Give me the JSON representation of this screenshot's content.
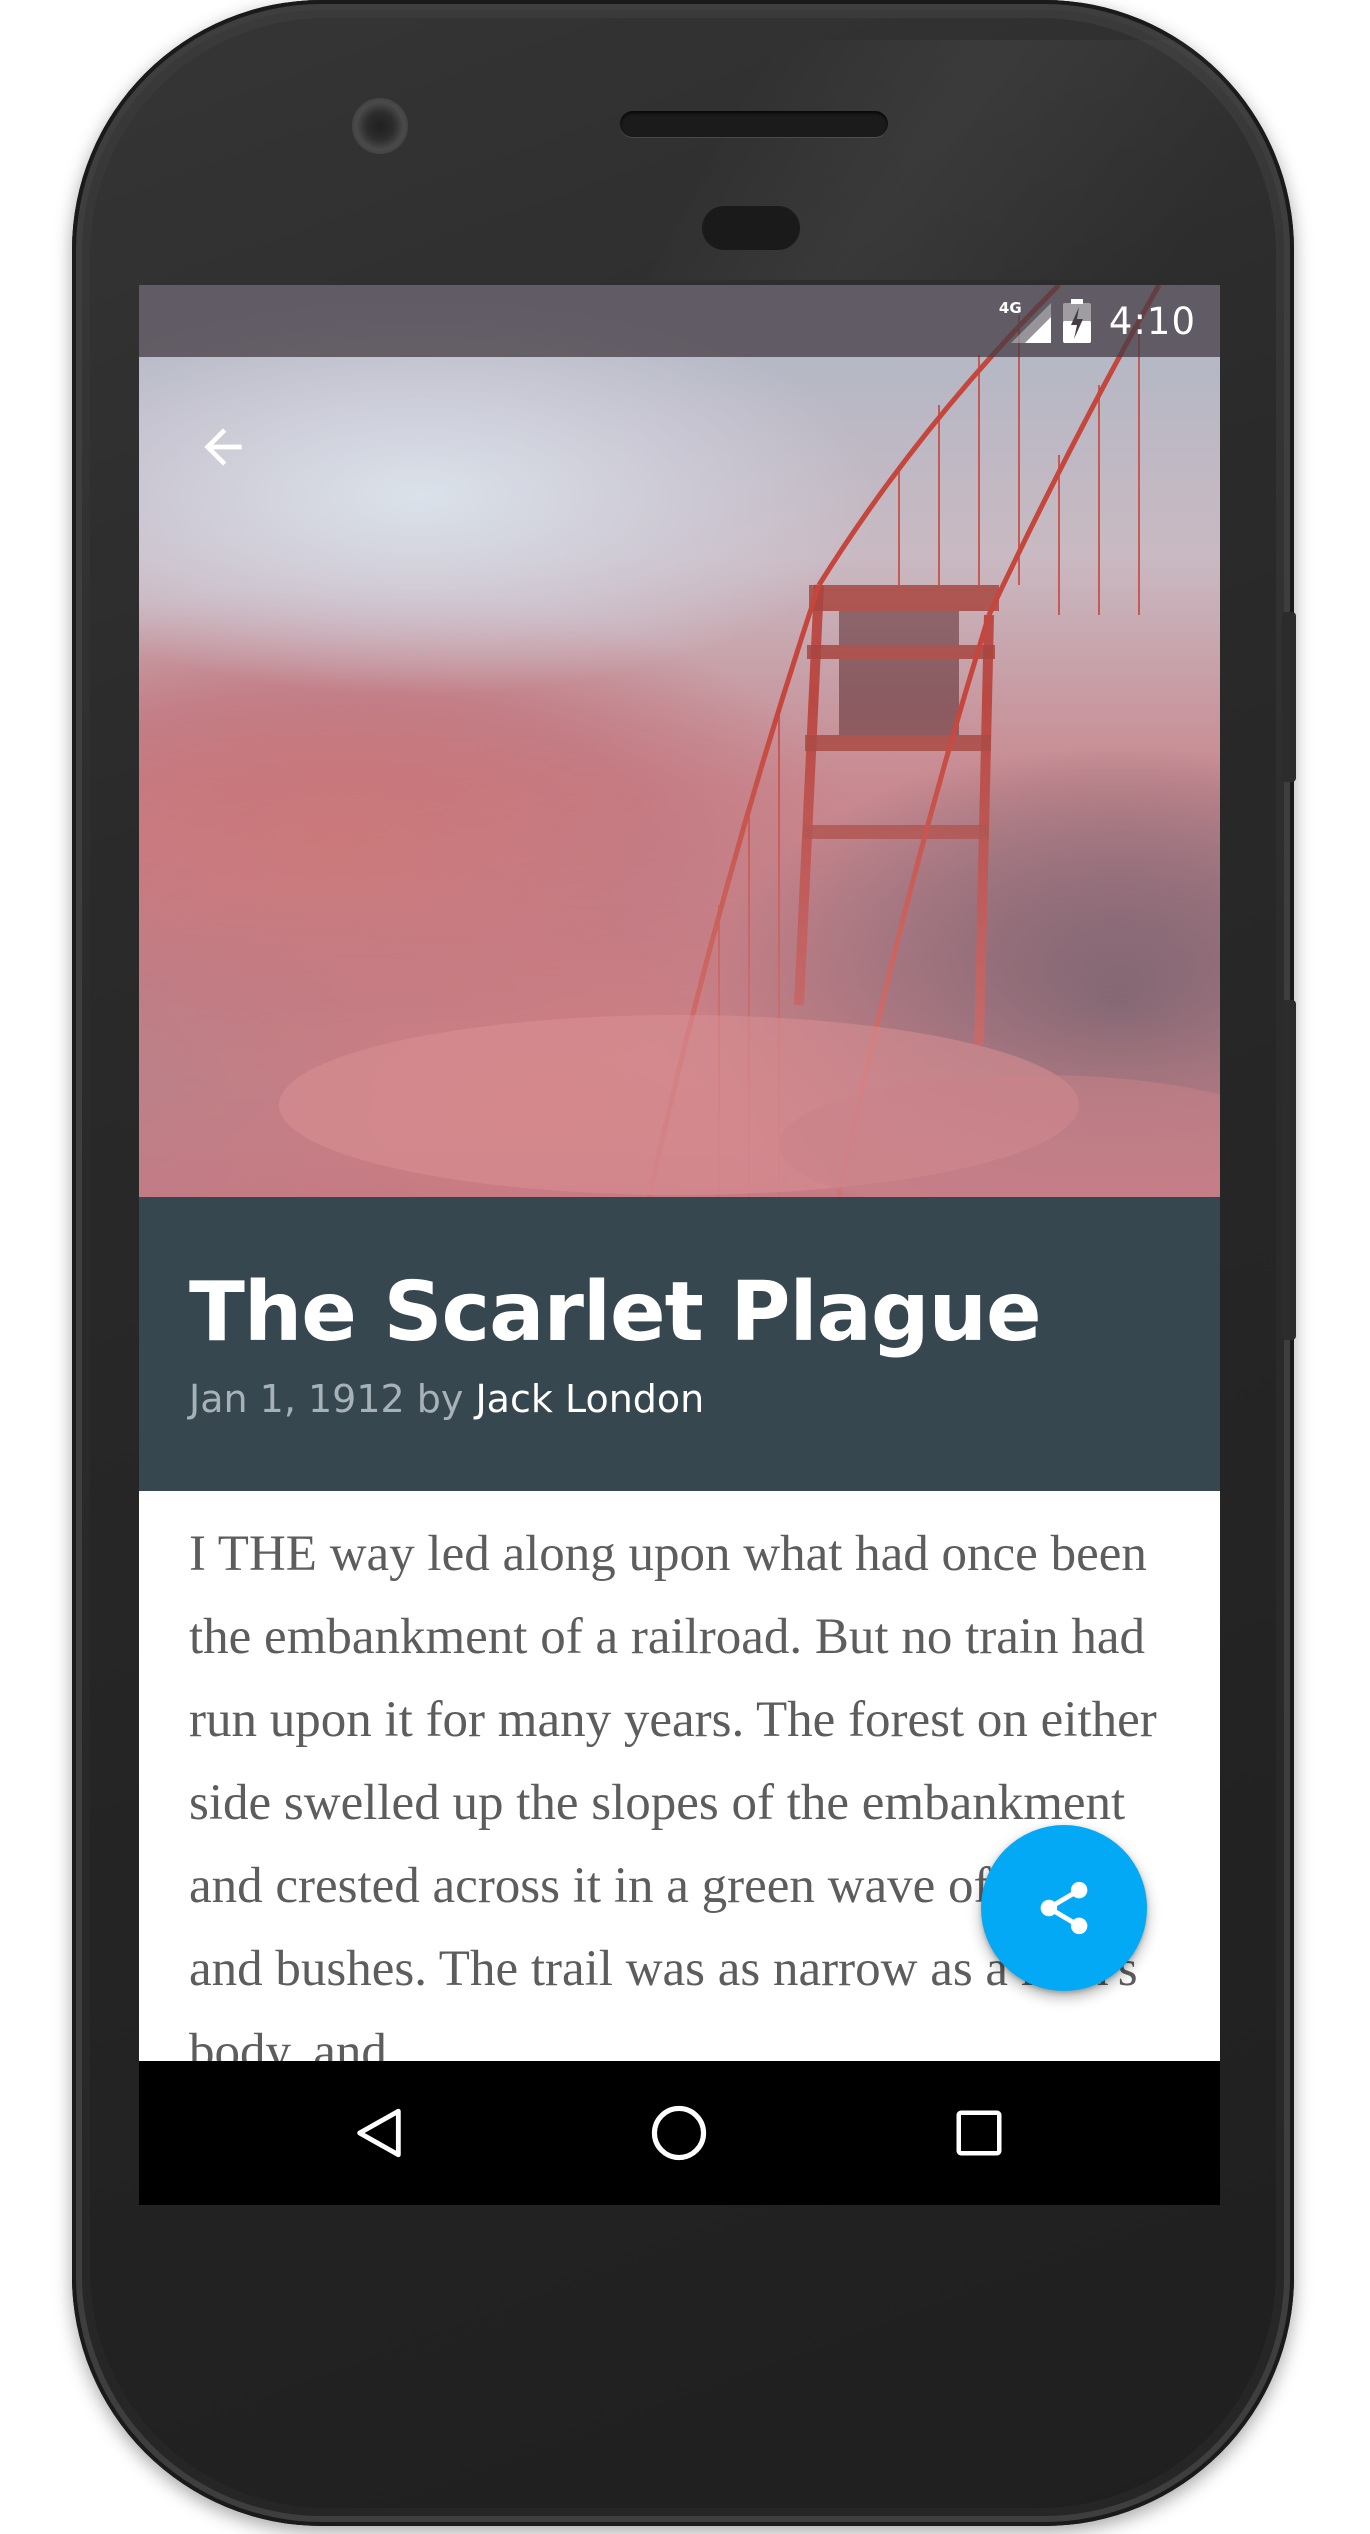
{
  "status_bar": {
    "network_label": "4G",
    "time": "4:10"
  },
  "hero": {
    "image_label": "fog-bridge-photo"
  },
  "article": {
    "title": "The Scarlet Plague",
    "date_prefix": "Jan 1, 1912 by ",
    "author": "Jack London",
    "body": "I THE way led along upon what had once been the embankment of a railroad. But no train had run upon it for many years. The forest on either side swelled up the slopes of the embankment and crested across it in a green wave of trees and bushes. The trail was as narrow as a man's body, and"
  },
  "actions": {
    "back_icon": "arrow-left-icon",
    "share_icon": "share-icon"
  },
  "navigation": {
    "back_icon": "nav-back-triangle-icon",
    "home_icon": "nav-home-circle-icon",
    "recents_icon": "nav-recents-square-icon"
  },
  "colors": {
    "title_band": "#37474f",
    "fab": "#03a9f4",
    "body_text": "#5d5d5d",
    "meta_text": "#a7b2b8",
    "nav_bar": "#000000"
  }
}
